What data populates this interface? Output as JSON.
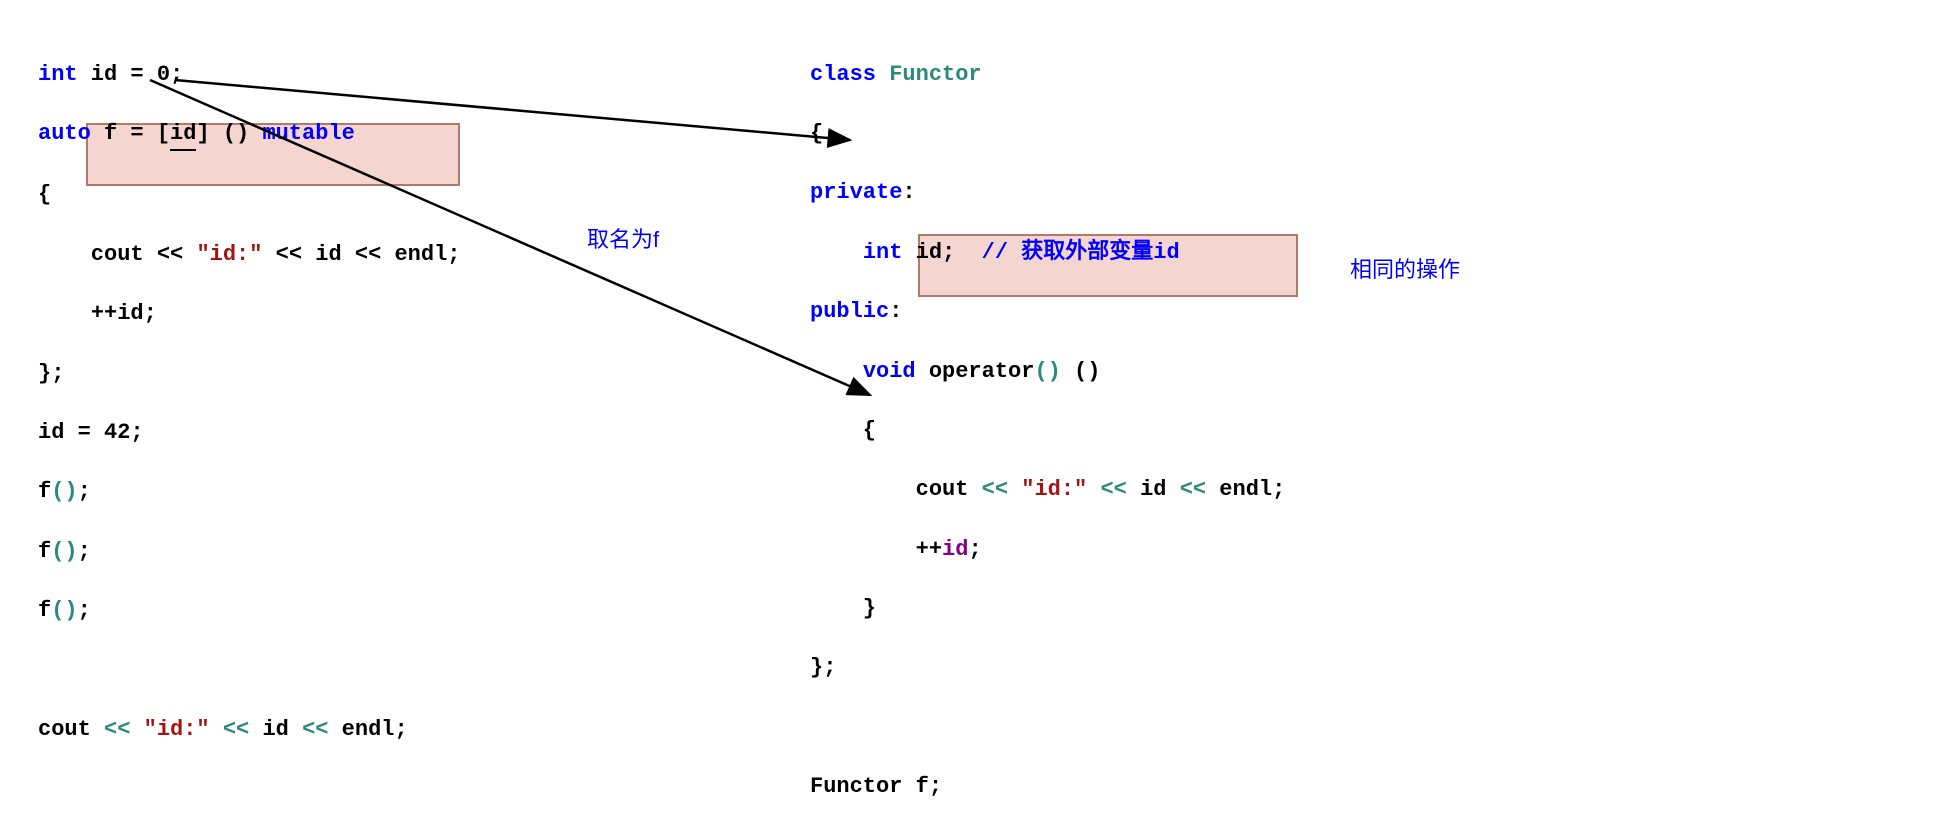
{
  "left": {
    "l1": {
      "a": "int",
      "b": " id = ",
      "c": "0",
      "d": ";"
    },
    "l2": {
      "a": "auto",
      "b": " f = [",
      "id": "id",
      "c": "] () ",
      "d": "mutable"
    },
    "l3": "{",
    "l4": {
      "a": "    cout ",
      "b": "<<",
      "c": " ",
      "d": "\"id:\"",
      "e": " ",
      "f": "<<",
      "g": " id ",
      "h": "<<",
      "i": " endl;"
    },
    "l5": {
      "a": "    ",
      "b": "++",
      "c": "id;"
    },
    "l6": "};",
    "l7": {
      "a": "id = ",
      "b": "42",
      "c": ";"
    },
    "l8": {
      "a": "f",
      "b": "()",
      "c": ";"
    },
    "l9": {
      "a": "f",
      "b": "()",
      "c": ";"
    },
    "l10": {
      "a": "f",
      "b": "()",
      "c": ";"
    },
    "l11": {
      "a": "cout ",
      "b": "<<",
      "c": " ",
      "d": "\"id:\"",
      "e": " ",
      "f": "<<",
      "g": " id ",
      "h": "<<",
      "i": " endl;"
    }
  },
  "right": {
    "l1": {
      "a": "class",
      "b": " ",
      "c": "Functor"
    },
    "l2": "{",
    "l3": {
      "a": "private",
      "b": ":"
    },
    "l4": {
      "a": "    ",
      "b": "int",
      "c": " id;  ",
      "d": "// 获取外部变量id"
    },
    "l5": {
      "a": "public",
      "b": ":"
    },
    "l6": {
      "a": "    ",
      "b": "void",
      "c": " ",
      "d": "operator",
      "e": "()",
      "f": " ()"
    },
    "l7": "    {",
    "l8": {
      "a": "        cout ",
      "b": "<<",
      "c": " ",
      "d": "\"id:\"",
      "e": " ",
      "f": "<<",
      "g": " id ",
      "h": "<<",
      "i": " endl;"
    },
    "l9": {
      "a": "        ",
      "b": "++",
      "c": "id",
      "d": ";"
    },
    "l10": "    }",
    "l11": "};",
    "l12": "",
    "l13": "Functor f;"
  },
  "annotations": {
    "named_f": "取名为f",
    "same_op": "相同的操作"
  }
}
